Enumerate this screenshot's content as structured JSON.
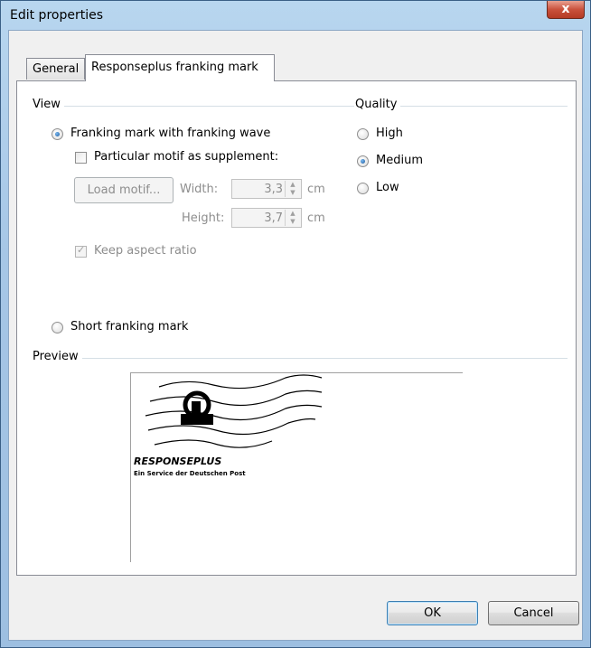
{
  "window": {
    "title": "Edit properties",
    "close_glyph": "x"
  },
  "tabs": [
    {
      "label": "General",
      "active": false
    },
    {
      "label": "Responseplus franking mark",
      "active": true
    }
  ],
  "view": {
    "label": "View",
    "option_wave": "Franking mark with franking wave",
    "option_wave_checked": true,
    "motif_checkbox": "Particular motif as supplement:",
    "motif_checked": false,
    "load_motif_button": "Load motif...",
    "width_label": "Width:",
    "width_value": "3,3",
    "width_unit": "cm",
    "height_label": "Height:",
    "height_value": "3,7",
    "height_unit": "cm",
    "keep_aspect": "Keep aspect ratio",
    "keep_aspect_checked": true,
    "option_short": "Short franking mark",
    "option_short_checked": false
  },
  "quality": {
    "label": "Quality",
    "options": [
      {
        "label": "High",
        "checked": false
      },
      {
        "label": "Medium",
        "checked": true
      },
      {
        "label": "Low",
        "checked": false
      }
    ]
  },
  "preview": {
    "label": "Preview",
    "brand": "RESPONSEPLUS",
    "subtitle": "Ein Service der Deutschen Post"
  },
  "buttons": {
    "ok": "OK",
    "cancel": "Cancel"
  },
  "colors": {
    "accent": "#1c5a9c",
    "title_bar": "#a6c6e6",
    "close": "#c9513c"
  }
}
